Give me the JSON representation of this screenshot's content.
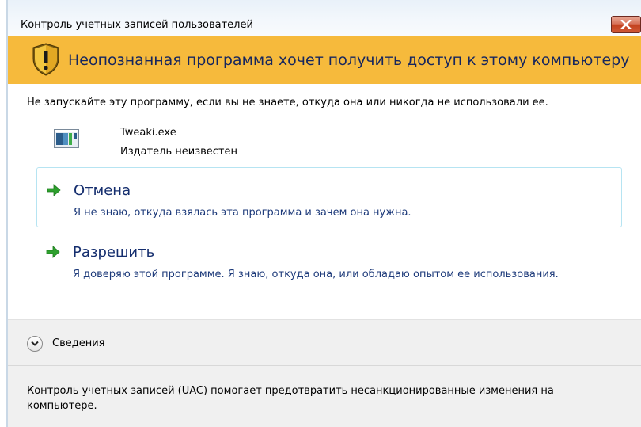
{
  "window": {
    "title": "Контроль учетных записей пользователей"
  },
  "banner": {
    "title": "Неопознанная программа хочет получить доступ к этому компьютеру"
  },
  "body": {
    "warning": "Не запускайте эту программу, если вы не знаете, откуда она или никогда не использовали ее.",
    "program": {
      "name": "Tweaki.exe",
      "publisher": "Издатель неизвестен"
    }
  },
  "options": {
    "cancel": {
      "title": "Отмена",
      "description": "Я не знаю, откуда взялась эта программа и зачем она нужна."
    },
    "allow": {
      "title": "Разрешить",
      "description": "Я доверяю этой программе. Я знаю, откуда она, или обладаю опытом ее использования."
    }
  },
  "details": {
    "label": "Сведения"
  },
  "footer": {
    "text": "Контроль учетных записей (UAC) помогает предотвратить несанкционированные изменения на компьютере."
  },
  "colors": {
    "banner": "#f6ba3c",
    "banner_text": "#16265e",
    "option_title": "#152e6e",
    "arrow": "#2ea02e",
    "close_button": "#c3421f"
  },
  "icons": {
    "close": "close-icon",
    "shield": "shield-warning-icon",
    "program": "program-icon",
    "arrow": "green-arrow-icon",
    "chevron": "chevron-down-icon"
  }
}
